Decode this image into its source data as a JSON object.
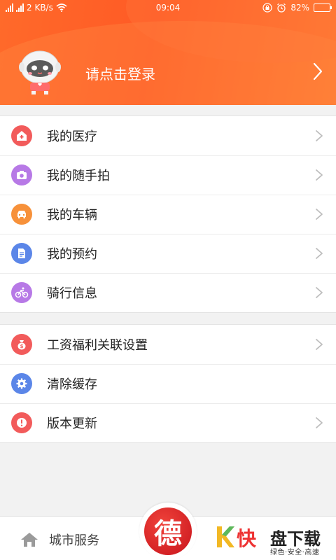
{
  "status_bar": {
    "network_speed": "2 KB/s",
    "time": "09:04",
    "battery": "82%",
    "battery_level": 0.82
  },
  "header": {
    "login_prompt": "请点击登录"
  },
  "menu_group_1": [
    {
      "label": "我的医疗",
      "icon": "medical-icon",
      "color": "#f25b5b"
    },
    {
      "label": "我的随手拍",
      "icon": "camera-icon",
      "color": "#b779e6"
    },
    {
      "label": "我的车辆",
      "icon": "car-icon",
      "color": "#f7913a"
    },
    {
      "label": "我的预约",
      "icon": "document-icon",
      "color": "#5b86e8"
    },
    {
      "label": "骑行信息",
      "icon": "bicycle-icon",
      "color": "#b779e6"
    }
  ],
  "menu_group_2": [
    {
      "label": "工资福利关联设置",
      "icon": "money-bag-icon",
      "color": "#f25b5b",
      "chevron": true
    },
    {
      "label": "清除缓存",
      "icon": "gear-icon",
      "color": "#5b86e8",
      "chevron": false
    },
    {
      "label": "版本更新",
      "icon": "exclamation-icon",
      "color": "#f25b5b",
      "chevron": true
    }
  ],
  "tabbar": {
    "city_service": "城市服务",
    "center_char": "德"
  },
  "brand": {
    "kuai": "快",
    "pan_xia_zai": "盘下载",
    "slogan": "绿色·安全·高速"
  },
  "colors": {
    "header_accent": "#ff5a25",
    "center_button": "#d8201f"
  }
}
